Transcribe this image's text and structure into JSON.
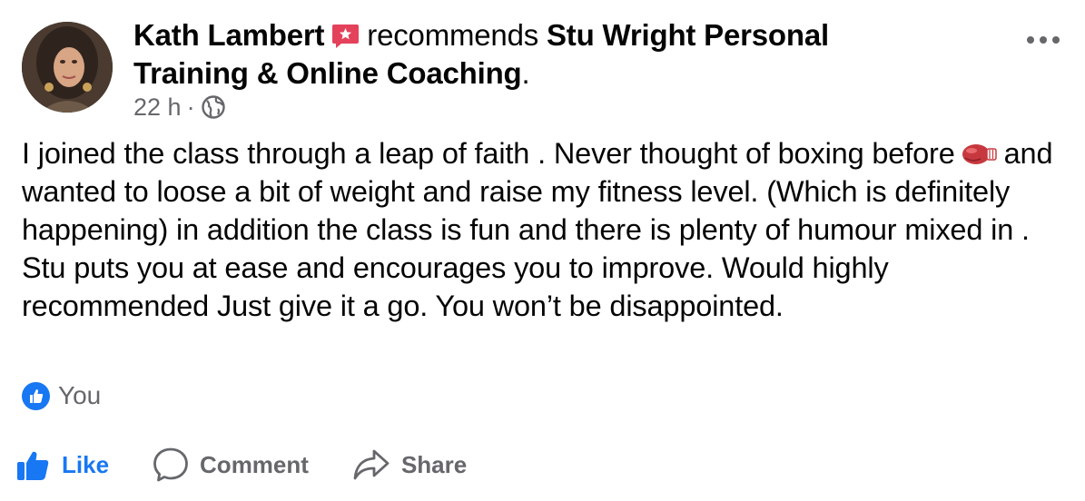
{
  "post": {
    "author": "Kath Lambert",
    "verb": "recommends",
    "page_name_line1": "Stu Wright Personal",
    "page_name_line2": "Training & Online Coaching",
    "period": ".",
    "time": "22 h",
    "separator": "·",
    "text_part1": "I joined the class through a leap of faith . Never thought of boxing before",
    "text_part2": "and wanted to loose a bit of weight and raise my fitness level. (Which is definitely happening) in addition the class is fun and there is plenty of humour mixed in . Stu puts you at ease and encourages you to improve. Would highly recommended Just give it a go. You won’t be disappointed.",
    "reactions_text": "You"
  },
  "actions": {
    "like": "Like",
    "comment": "Comment",
    "share": "Share"
  },
  "icons": {
    "recommend_badge": "recommend-star-icon",
    "audience": "globe-icon",
    "more": "more-options-icon",
    "emoji": "boxing-glove-icon",
    "reaction": "like-reaction-icon",
    "like": "thumbs-up-icon",
    "comment": "comment-bubble-icon",
    "share": "share-arrow-icon"
  },
  "colors": {
    "like_blue": "#1877f2",
    "secondary_text": "#65676b",
    "badge_red": "#e4415b"
  }
}
